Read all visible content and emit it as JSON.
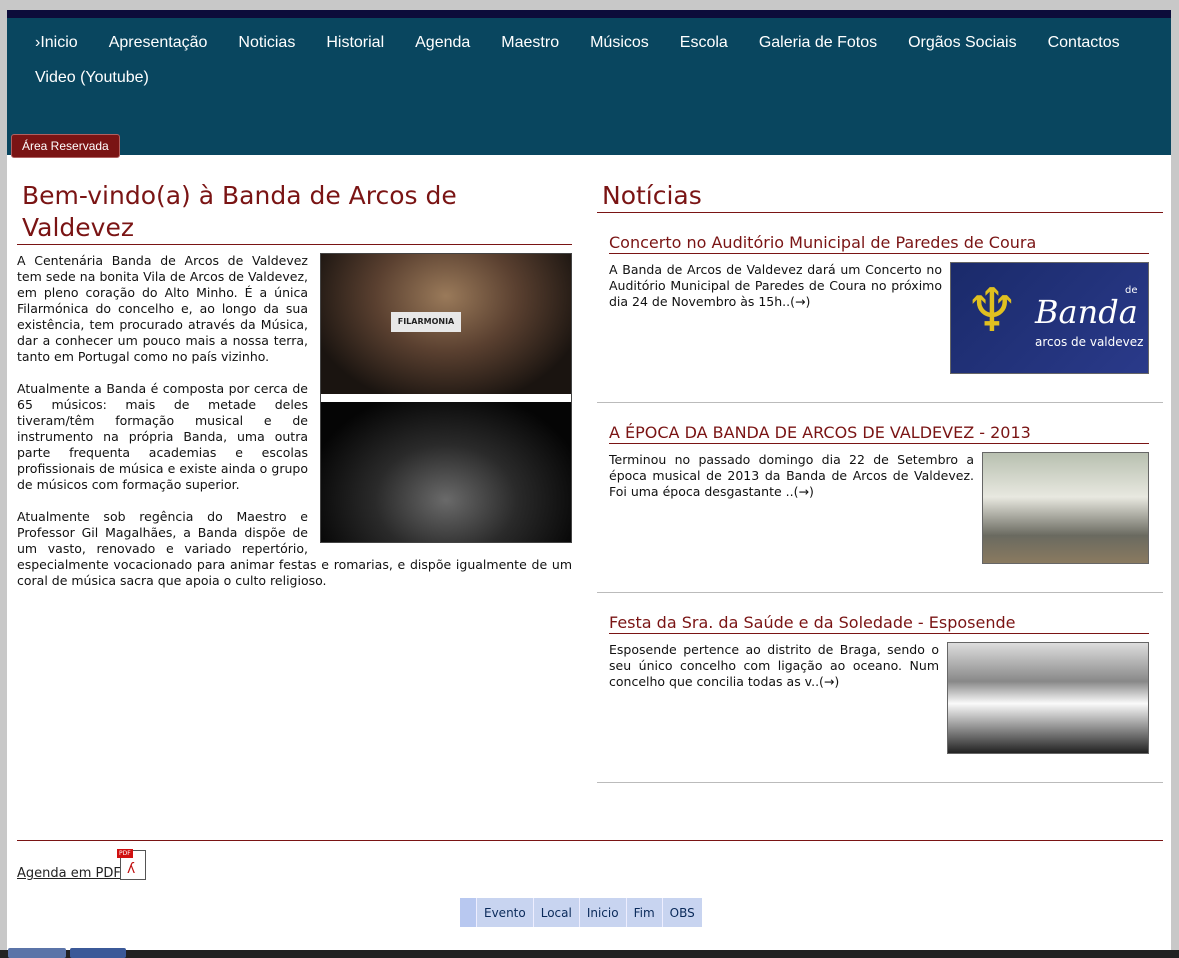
{
  "nav": {
    "items": [
      "›Inicio",
      "Apresentação",
      "Noticias",
      "Historial",
      "Agenda",
      "Maestro",
      "Músicos",
      "Escola",
      "Galeria de Fotos",
      "Orgãos Sociais",
      "Contactos",
      "Video (Youtube)"
    ],
    "reserved": "Área Reservada"
  },
  "left": {
    "title": "Bem-vindo(a) à Banda de Arcos de Valdevez",
    "paragraphs": [
      "A Centenária Banda de Arcos de Valdevez tem sede na bonita Vila de Arcos de Valdevez, em pleno coração do Alto Minho. É a única Filarmónica do concelho e, ao longo da sua existência, tem procurado através da Música, dar a conhecer um pouco mais a nossa terra, tanto em Portugal como no país vizinho.",
      "Atualmente a Banda é composta por cerca de 65 músicos: mais de metade deles tiveram/têm formação musical e de instrumento na própria Banda, uma outra parte frequenta academias e escolas profissionais de música e existe ainda o grupo de músicos com formação superior.",
      "Atualmente sob regência do Maestro e Professor Gil Magalhães, a Banda dispõe de um vasto, renovado e variado repertório, especialmente vocacionado para animar festas e romarias, e dispõe igualmente de um coral de música sacra que apoia o culto religioso."
    ],
    "banner_text": "FILARMONIA"
  },
  "right": {
    "title": "Notícias",
    "news": [
      {
        "title": "Concerto no Auditório Municipal de Paredes de Coura",
        "text": "A Banda de Arcos de Valdevez dará um Concerto no Auditório Municipal de Paredes de Coura no próximo dia 24 de Novembro às 15h..(→)",
        "logo_big": "Banda",
        "logo_small": "arcos de valdevez",
        "logo_de": "de"
      },
      {
        "title": "A ÉPOCA DA BANDA DE ARCOS DE VALDEVEZ - 2013",
        "text": "Terminou no passado domingo dia 22 de Setembro a época musical de 2013 da Banda de Arcos de Valdevez. Foi uma época desgastante ..(→)"
      },
      {
        "title": "Festa da Sra. da Saúde e da Soledade - Esposende",
        "text": "Esposende pertence ao distrito de Braga, sendo o seu único concelho com ligação ao oceano. Num concelho que concilia todas as v..(→)"
      }
    ]
  },
  "footer": {
    "pdf_link": "Agenda em PDF",
    "pdf_tag": "PDF",
    "tabs": [
      "Evento",
      "Local",
      "Inicio",
      "Fim",
      "OBS"
    ]
  },
  "colors": {
    "accent": "#7a1414",
    "nav": "#09465f"
  }
}
